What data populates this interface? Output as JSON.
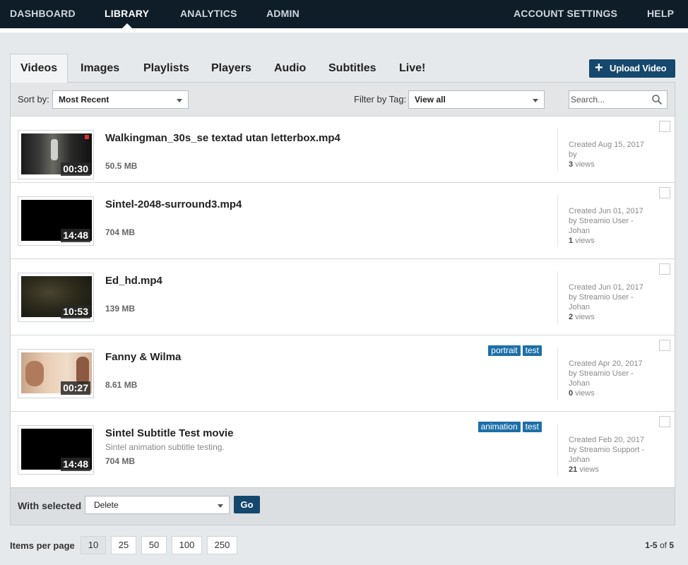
{
  "nav": {
    "left": [
      "DASHBOARD",
      "LIBRARY",
      "ANALYTICS",
      "ADMIN"
    ],
    "right": [
      "ACCOUNT SETTINGS",
      "HELP"
    ],
    "active": "LIBRARY"
  },
  "tabs": [
    "Videos",
    "Images",
    "Playlists",
    "Players",
    "Audio",
    "Subtitles",
    "Live!"
  ],
  "active_tab": "Videos",
  "upload_button": "Upload Video",
  "toolbar": {
    "sort_label": "Sort by:",
    "sort_value": "Most Recent",
    "filter_label": "Filter by Tag:",
    "filter_value": "View all",
    "search_placeholder": "Search..."
  },
  "videos": [
    {
      "title": "Walkingman_30s_se textad utan letterbox.mp4",
      "description": "",
      "size": "50.5 MB",
      "duration": "00:30",
      "tags": [],
      "created": "Created Aug 15, 2017",
      "by": "by",
      "by_name": "",
      "views_count": "3",
      "views_label": "views"
    },
    {
      "title": "Sintel-2048-surround3.mp4",
      "description": "",
      "size": "704 MB",
      "duration": "14:48",
      "tags": [],
      "created": "Created Jun 01, 2017",
      "by": "by",
      "by_name": "Streamio User - Johan",
      "views_count": "1",
      "views_label": "views"
    },
    {
      "title": "Ed_hd.mp4",
      "description": "",
      "size": "139 MB",
      "duration": "10:53",
      "tags": [],
      "created": "Created Jun 01, 2017",
      "by": "by",
      "by_name": "Streamio User - Johan",
      "views_count": "2",
      "views_label": "views"
    },
    {
      "title": "Fanny & Wilma",
      "description": "",
      "size": "8.61 MB",
      "duration": "00:27",
      "tags": [
        "portrait",
        "test"
      ],
      "created": "Created Apr 20, 2017",
      "by": "by",
      "by_name": "Streamio User - Johan",
      "views_count": "0",
      "views_label": "views"
    },
    {
      "title": "Sintel Subtitle Test movie",
      "description": "Sintel animation subtitle testing.",
      "size": "704 MB",
      "duration": "14:48",
      "tags": [
        "animation",
        "test"
      ],
      "created": "Created Feb 20, 2017",
      "by": "by",
      "by_name": "Streamio Support - Johan",
      "views_count": "21",
      "views_label": "views"
    }
  ],
  "bulk": {
    "label": "With selected",
    "action": "Delete",
    "go": "Go"
  },
  "pagination": {
    "items_per_page_label": "Items per page",
    "options": [
      "10",
      "25",
      "50",
      "100",
      "250"
    ],
    "selected": "10",
    "range": "1-5",
    "of": "of",
    "total": "5"
  },
  "colors": {
    "nav_bg": "#0f1d29",
    "accent": "#15486c",
    "tag": "#1d6fa8"
  }
}
